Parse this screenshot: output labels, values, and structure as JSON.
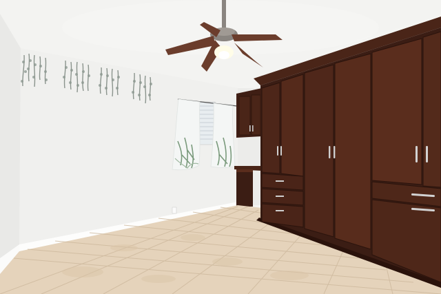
{
  "scene": {
    "description_visible_text": "",
    "colors": {
      "ceiling": "#f3f3f1",
      "wall_left": "#eeeeec",
      "wall_back": "#f2f2f0",
      "floor_tile": "#e6d4bc",
      "floor_grout": "#cdb89c",
      "baseboard": "#fbfbfa",
      "cabinet_dark": "#3b1d14",
      "cabinet_mid": "#4a2518",
      "cabinet_light": "#5a2d1d",
      "handle": "#c9c9c9",
      "fan_blade": "#6b3d2c",
      "fan_metal": "#8a8580",
      "curtain": "#f2f4f3",
      "curtain_leaf": "#7a9a7c",
      "vine": "#8e9a92",
      "window_blind": "#dfe5ea"
    }
  }
}
